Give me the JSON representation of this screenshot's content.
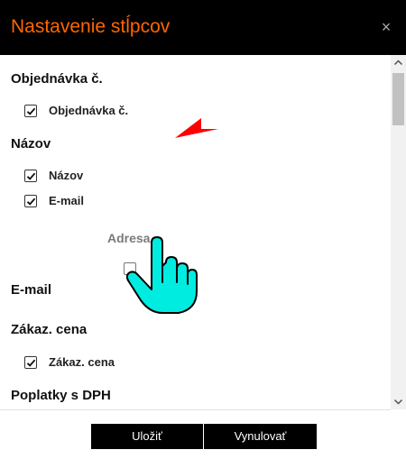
{
  "dialog": {
    "title": "Nastavenie stĺpcov",
    "close_label": "×"
  },
  "groups": [
    {
      "heading": "Objednávka č.",
      "items": [
        {
          "label": "Objednávka č.",
          "checked": true
        }
      ]
    },
    {
      "heading": "Názov",
      "items": [
        {
          "label": "Názov",
          "checked": true
        },
        {
          "label": "E-mail",
          "checked": true
        }
      ]
    },
    {
      "heading": "E-mail",
      "items": []
    },
    {
      "heading": "Zákaz. cena",
      "items": [
        {
          "label": "Zákaz. cena",
          "checked": true
        }
      ]
    },
    {
      "heading": "Poplatky s DPH",
      "items": []
    }
  ],
  "drag": {
    "ghost_label": "Adresa"
  },
  "overlays": {
    "undo_arrow_color": "#ff0000",
    "hand_cursor_color": "#00e6dd",
    "undo_arrow_icon": "undo-arrow-icon",
    "hand_cursor_icon": "hand-cursor-icon"
  },
  "scrollbar": {
    "up_icon": "chevron-up-icon",
    "down_icon": "chevron-down-icon"
  },
  "footer": {
    "save_label": "Uložiť",
    "reset_label": "Vynulovať"
  },
  "colors": {
    "title": "#ff6600",
    "titlebar": "#000000",
    "button_bg": "#000000",
    "button_text": "#ffffff"
  }
}
